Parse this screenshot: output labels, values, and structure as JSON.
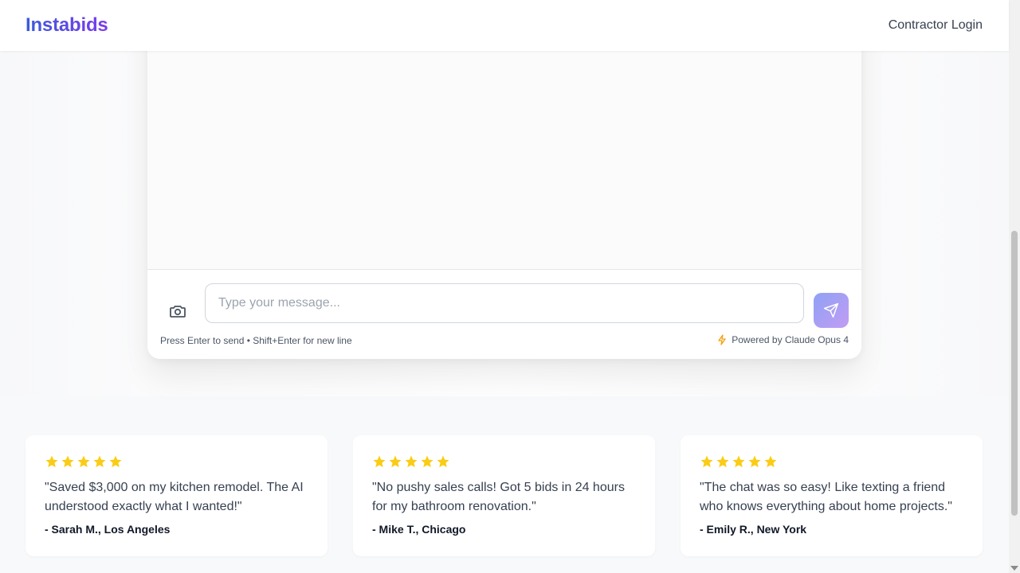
{
  "header": {
    "logo": "Instabids",
    "login_link": "Contractor Login"
  },
  "chat": {
    "input_placeholder": "Type your message...",
    "input_value": "",
    "hint": "Press Enter to send • Shift+Enter for new line",
    "powered_by": "Powered by Claude Opus 4",
    "camera_icon": "camera-icon",
    "send_icon": "send-icon",
    "bolt_icon": "lightning-bolt-icon"
  },
  "testimonials": [
    {
      "rating": 5,
      "quote": "\"Saved $3,000 on my kitchen remodel. The AI understood exactly what I wanted!\"",
      "author": "- Sarah M., Los Angeles"
    },
    {
      "rating": 5,
      "quote": "\"No pushy sales calls! Got 5 bids in 24 hours for my bathroom renovation.\"",
      "author": "- Mike T., Chicago"
    },
    {
      "rating": 5,
      "quote": "\"The chat was so easy! Like texting a friend who knows everything about home projects.\"",
      "author": "- Emily R., New York"
    }
  ],
  "colors": {
    "brand_gradient_start": "#3b5bdb",
    "brand_gradient_end": "#7c3aed",
    "star": "#facc15",
    "bolt": "#f59e0b"
  }
}
